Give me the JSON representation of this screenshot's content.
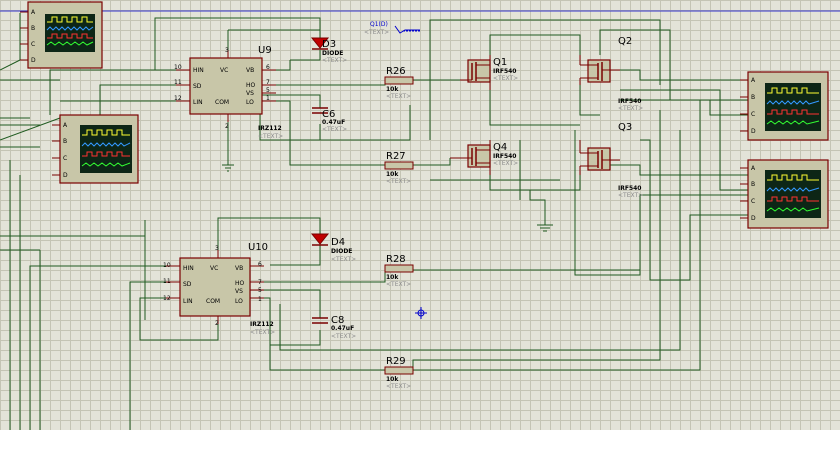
{
  "schematic": {
    "u9": {
      "ref": "U9",
      "part": "IRZ112",
      "text": "<TEXT>",
      "pins": {
        "hin": "10",
        "sd": "11",
        "lin": "12",
        "vc": "3",
        "com": "2",
        "vb": "6",
        "ho": "7",
        "vs": "5",
        "lo": "1"
      },
      "labels": {
        "hin": "HIN",
        "sd": "SD",
        "lin": "LIN",
        "vc": "VC",
        "com": "COM",
        "vb": "VB",
        "ho": "HO",
        "vs": "VS",
        "lo": "LO"
      }
    },
    "u10": {
      "ref": "U10",
      "part": "IRZ112",
      "text": "<TEXT>",
      "pins": {
        "hin": "10",
        "sd": "11",
        "lin": "12",
        "vc": "3",
        "com": "2",
        "vb": "6",
        "ho": "7",
        "vs": "5",
        "lo": "1"
      },
      "labels": {
        "hin": "HIN",
        "sd": "SD",
        "lin": "LIN",
        "vc": "VC",
        "com": "COM",
        "vb": "VB",
        "ho": "HO",
        "vs": "VS",
        "lo": "LO"
      }
    },
    "d3": {
      "ref": "D3",
      "value": "DIODE",
      "text": "<TEXT>"
    },
    "d4": {
      "ref": "D4",
      "value": "DIODE",
      "text": "<TEXT>"
    },
    "c6": {
      "ref": "C6",
      "value": "0.47uF",
      "text": "<TEXT>"
    },
    "c8": {
      "ref": "C8",
      "value": "0.47uF",
      "text": "<TEXT>"
    },
    "r26": {
      "ref": "R26",
      "value": "10k",
      "text": "<TEXT>"
    },
    "r27": {
      "ref": "R27",
      "value": "10k",
      "text": "<TEXT>"
    },
    "r28": {
      "ref": "R28",
      "value": "10k",
      "text": "<TEXT>"
    },
    "r29": {
      "ref": "R29",
      "value": "10k",
      "text": "<TEXT>"
    },
    "q1": {
      "ref": "Q1",
      "value": "IRF540",
      "text": "<TEXT>"
    },
    "q2": {
      "ref": "Q2",
      "value": "IRF540",
      "text": "<TEXT>"
    },
    "q3": {
      "ref": "Q3",
      "value": "IRF540",
      "text": "<TEXT>"
    },
    "q4": {
      "ref": "Q4",
      "value": "IRF540",
      "text": "<TEXT>"
    },
    "terminal": {
      "label": "Q1(D)",
      "text": "<TEXT>"
    },
    "scope_pins": [
      "A",
      "B",
      "C",
      "D"
    ]
  },
  "colors": {
    "wire": "#1f5a1f",
    "body": "#c8c6a8",
    "outline": "#7a0000",
    "grid": "#c4c4b4",
    "background": "#e3e3d8",
    "probe": "#0000cc"
  },
  "icons": {
    "probe": "crosshair-icon",
    "ground": "ground-icon"
  }
}
